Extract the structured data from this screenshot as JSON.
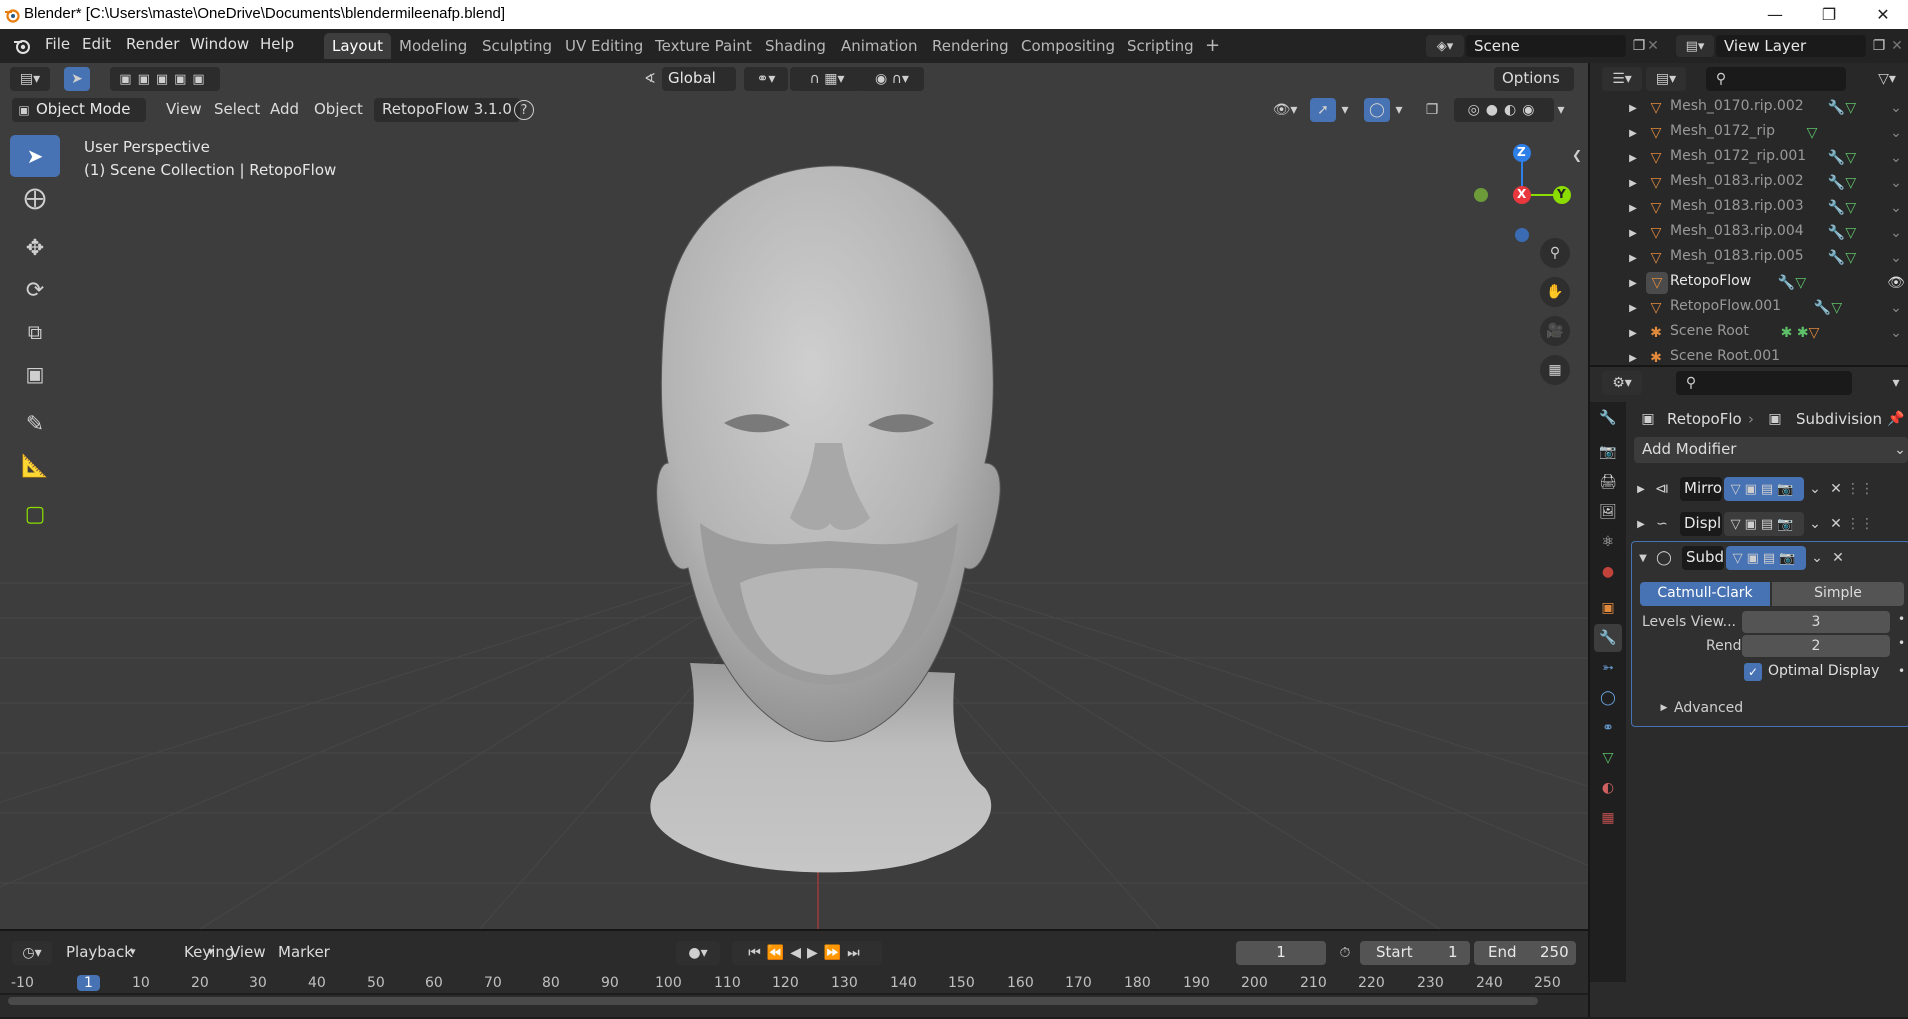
{
  "window": {
    "title": "Blender* [C:\\Users\\maste\\OneDrive\\Documents\\blendermileenafp.blend]",
    "minimize": "—",
    "maximize": "❐",
    "close": "✕"
  },
  "menu": {
    "file": "File",
    "edit": "Edit",
    "render": "Render",
    "window": "Window",
    "help": "Help"
  },
  "workspaces": [
    "Layout",
    "Modeling",
    "Sculpting",
    "UV Editing",
    "Texture Paint",
    "Shading",
    "Animation",
    "Rendering",
    "Compositing",
    "Scripting"
  ],
  "workspace_add": "+",
  "scene": {
    "name": "Scene",
    "view_layer": "View Layer"
  },
  "viewport_header": {
    "orientation": "Global",
    "options": "Options",
    "mode": "Object Mode",
    "view": "View",
    "select": "Select",
    "add": "Add",
    "object": "Object",
    "addon": "RetopoFlow 3.1.0",
    "help_glyph": "?"
  },
  "viewport": {
    "perspective": "User Perspective",
    "collection": "(1) Scene Collection | RetopoFlow",
    "gizmo": {
      "z": "Z",
      "x": "X",
      "y": "Y"
    }
  },
  "outliner": {
    "rows": [
      {
        "name": "Mesh_0170.rip.002",
        "selected": false
      },
      {
        "name": "Mesh_0172_rip",
        "selected": false
      },
      {
        "name": "Mesh_0172_rip.001",
        "selected": false
      },
      {
        "name": "Mesh_0183.rip.002",
        "selected": false
      },
      {
        "name": "Mesh_0183.rip.003",
        "selected": false
      },
      {
        "name": "Mesh_0183.rip.004",
        "selected": false
      },
      {
        "name": "Mesh_0183.rip.005",
        "selected": false
      },
      {
        "name": "RetopoFlow",
        "selected": true
      },
      {
        "name": "RetopoFlow.001",
        "selected": false
      },
      {
        "name": "Scene Root",
        "selected": false
      },
      {
        "name": "Scene Root.001",
        "selected": false
      }
    ]
  },
  "properties": {
    "object_name": "RetopoFlo",
    "modifier_name": "Subdivision",
    "add_modifier": "Add Modifier",
    "modifiers": [
      {
        "name": "Mirro",
        "expanded": false
      },
      {
        "name": "Displ",
        "expanded": false
      },
      {
        "name": "Subd",
        "expanded": true
      }
    ],
    "subdivision": {
      "catmull_clark": "Catmull-Clark",
      "simple": "Simple",
      "levels_label": "Levels View...",
      "levels_value": "3",
      "render_label": "Render",
      "render_value": "2",
      "optimal_display": "Optimal Display",
      "advanced": "Advanced"
    }
  },
  "timeline": {
    "playback": "Playback",
    "keying": "Keying",
    "view": "View",
    "marker": "Marker",
    "current_frame": "1",
    "start_label": "Start",
    "start_value": "1",
    "end_label": "End",
    "end_value": "250",
    "ruler": [
      "-10",
      "1",
      "10",
      "20",
      "30",
      "40",
      "50",
      "60",
      "70",
      "80",
      "90",
      "100",
      "110",
      "120",
      "130",
      "140",
      "150",
      "160",
      "170",
      "180",
      "190",
      "200",
      "210",
      "220",
      "230",
      "240",
      "250"
    ]
  },
  "colors": {
    "accent": "#4772b3",
    "axis_x": "#e8383d",
    "axis_y": "#8bdc00",
    "axis_z": "#2e7fe8",
    "mesh_orange": "#e28a3c"
  }
}
